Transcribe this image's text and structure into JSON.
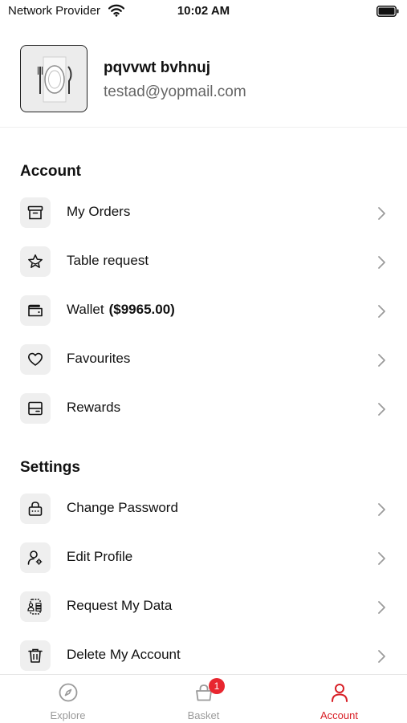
{
  "status_bar": {
    "provider": "Network Provider",
    "time": "10:02 AM",
    "icons": [
      "wifi-icon",
      "battery-icon"
    ]
  },
  "profile": {
    "name": "pqvvwt bvhnuj",
    "email": "testad@yopmail.com",
    "avatar_icon": "plate-cutlery-icon"
  },
  "account": {
    "title": "Account",
    "items": [
      {
        "label": "My Orders",
        "extra": "",
        "icon": "archive-box-icon"
      },
      {
        "label": "Table request",
        "extra": "",
        "icon": "star-icon"
      },
      {
        "label": "Wallet",
        "extra": "($9965.00)",
        "icon": "wallet-icon"
      },
      {
        "label": "Favourites",
        "extra": "",
        "icon": "heart-icon"
      },
      {
        "label": "Rewards",
        "extra": "",
        "icon": "card-icon"
      }
    ]
  },
  "settings": {
    "title": "Settings",
    "items": [
      {
        "label": "Change Password",
        "icon": "lock-icon"
      },
      {
        "label": "Edit Profile",
        "icon": "user-gear-icon"
      },
      {
        "label": "Request My Data",
        "icon": "data-request-icon"
      },
      {
        "label": "Delete My Account",
        "icon": "trash-icon"
      }
    ]
  },
  "tabbar": {
    "tabs": [
      {
        "label": "Explore",
        "icon": "compass-icon",
        "active": false
      },
      {
        "label": "Basket",
        "icon": "basket-icon",
        "active": false,
        "badge": "1"
      },
      {
        "label": "Account",
        "icon": "user-icon",
        "active": true
      }
    ]
  },
  "colors": {
    "accent": "#d81f26",
    "badge": "#e8262f",
    "icon_bg": "#efefef",
    "inactive_tab": "#9a9a9a"
  }
}
